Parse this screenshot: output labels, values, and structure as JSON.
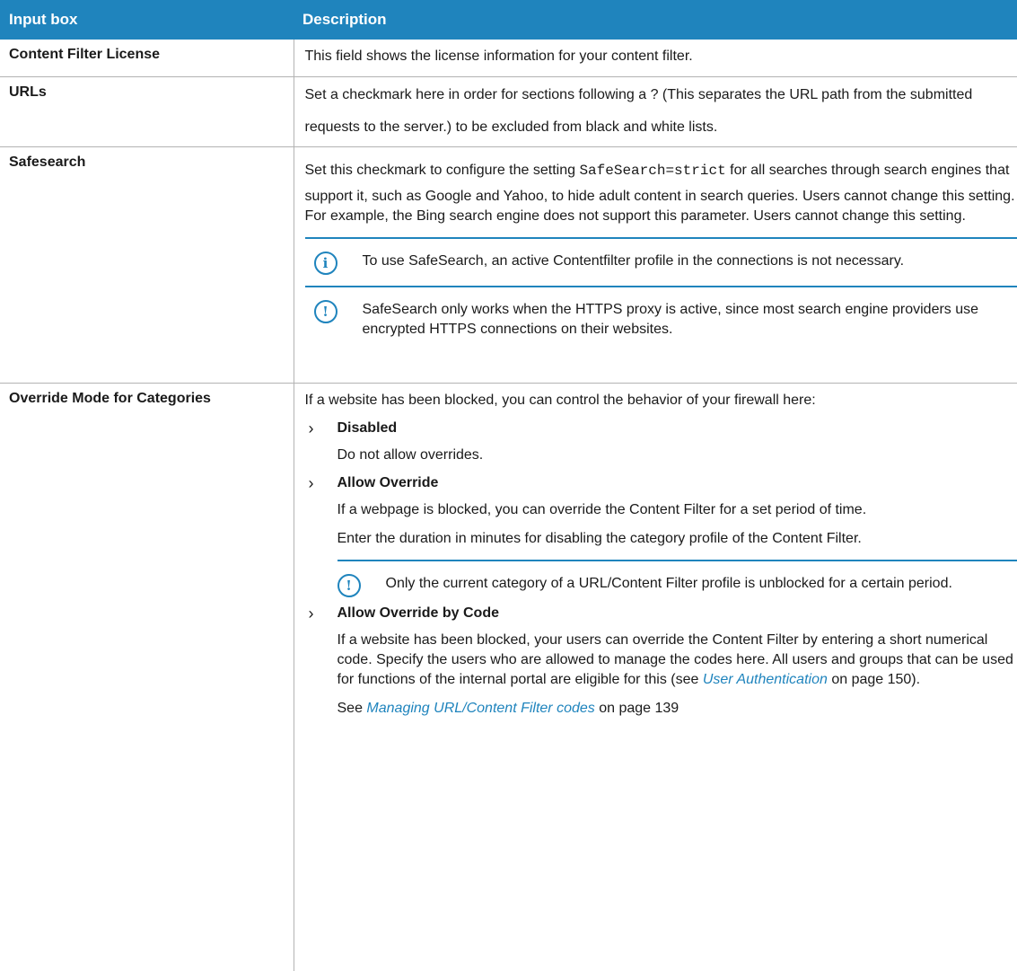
{
  "table": {
    "headers": [
      "Input box",
      "Description"
    ],
    "rows": {
      "license": {
        "name": "Content Filter License",
        "text": "This field shows the license information for your content filter."
      },
      "urls": {
        "name": "URLs",
        "text": "Set a checkmark here in order for sections following a ? (This separates the URL path from the submitted requests to the server.) to be excluded from black and white lists."
      },
      "safesearch": {
        "name": "Safesearch",
        "text_before": "Set this checkmark to configure the setting ",
        "code": "SafeSearch=strict",
        "text_after": " for all searches through search engines that support it, such as Google and Yahoo, to hide adult content in search queries. Users cannot change this setting. For example, the Bing search engine does not support this parameter. Users cannot change this setting.",
        "info_note": "To use SafeSearch, an active Contentfilter profile in the connections is not necessary.",
        "warn_note": "SafeSearch only works when the HTTPS proxy is active, since most search engine providers use encrypted HTTPS connections on their websites."
      },
      "override": {
        "name": "Override Mode for Categories",
        "intro": "If a website has been blocked, you can control the behavior of your firewall here:",
        "disabled_label": "Disabled",
        "disabled_text": "Do not allow overrides.",
        "allow_label": "Allow Override",
        "allow_text1": "If a webpage is blocked, you can override the Content Filter for a set period of time.",
        "allow_text2": "Enter the duration in minutes for disabling the category profile of the Content Filter.",
        "allow_note": "Only the current category of a URL/Content Filter profile is unblocked for a certain period.",
        "code_label": "Allow Override by Code",
        "code_text_before": "If a website has been blocked, your users can override the Content Filter by entering a short numerical code. Specify the users who are allowed to manage the codes here. All users and groups that can be used for functions of the internal portal are eligible for this (see ",
        "code_link": "User Authentication",
        "code_text_after": " on page 150).",
        "see_before": "See ",
        "see_link": "Managing URL/Content Filter codes",
        "see_after": " on page 139"
      }
    }
  },
  "icons": {
    "info": "i",
    "warning": "!",
    "chevron": "›"
  },
  "colors": {
    "accent": "#1f84bd"
  }
}
